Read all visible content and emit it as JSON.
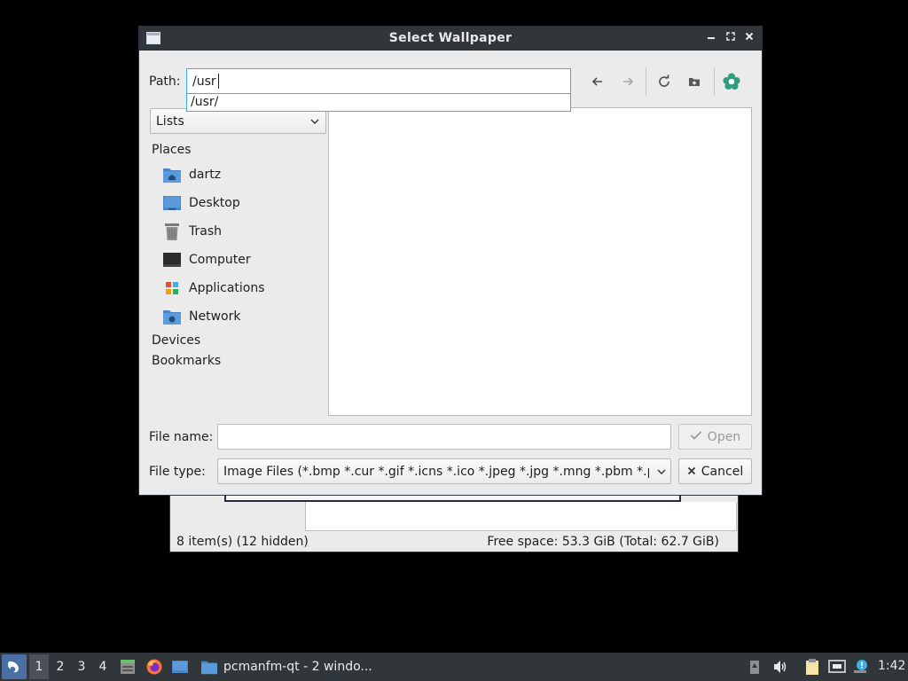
{
  "background_window": {
    "status_left": "8 item(s) (12 hidden)",
    "status_right": "Free space: 53.3 GiB (Total: 62.7 GiB)"
  },
  "dialog": {
    "title": "Select Wallpaper",
    "path": {
      "label": "Path:",
      "value": "/usr",
      "suggestion": "/usr/"
    },
    "view_mode": "Lists",
    "sidebar": {
      "places_header": "Places",
      "items": [
        {
          "label": "dartz",
          "icon": "home-folder-icon"
        },
        {
          "label": "Desktop",
          "icon": "desktop-icon"
        },
        {
          "label": "Trash",
          "icon": "trash-icon"
        },
        {
          "label": "Computer",
          "icon": "computer-icon"
        },
        {
          "label": "Applications",
          "icon": "applications-icon"
        },
        {
          "label": "Network",
          "icon": "network-icon"
        }
      ],
      "devices_header": "Devices",
      "bookmarks_header": "Bookmarks"
    },
    "file_name": {
      "label": "File name:",
      "value": ""
    },
    "file_type": {
      "label": "File type:",
      "value": "Image Files (*.bmp *.cur *.gif *.icns *.ico *.jpeg *.jpg *.mng *.pbm *.pgm"
    },
    "open_label": "Open",
    "cancel_label": "Cancel"
  },
  "taskbar": {
    "workspaces": [
      "1",
      "2",
      "3",
      "4"
    ],
    "active_workspace": "1",
    "task_label": "pcmanfm-qt - 2 windo...",
    "clock": "1:42"
  },
  "colors": {
    "titlebar": "#31363b",
    "accent": "#3daee9",
    "dialog_bg": "#ebebeb",
    "folder_blue": "#4a86c8"
  }
}
